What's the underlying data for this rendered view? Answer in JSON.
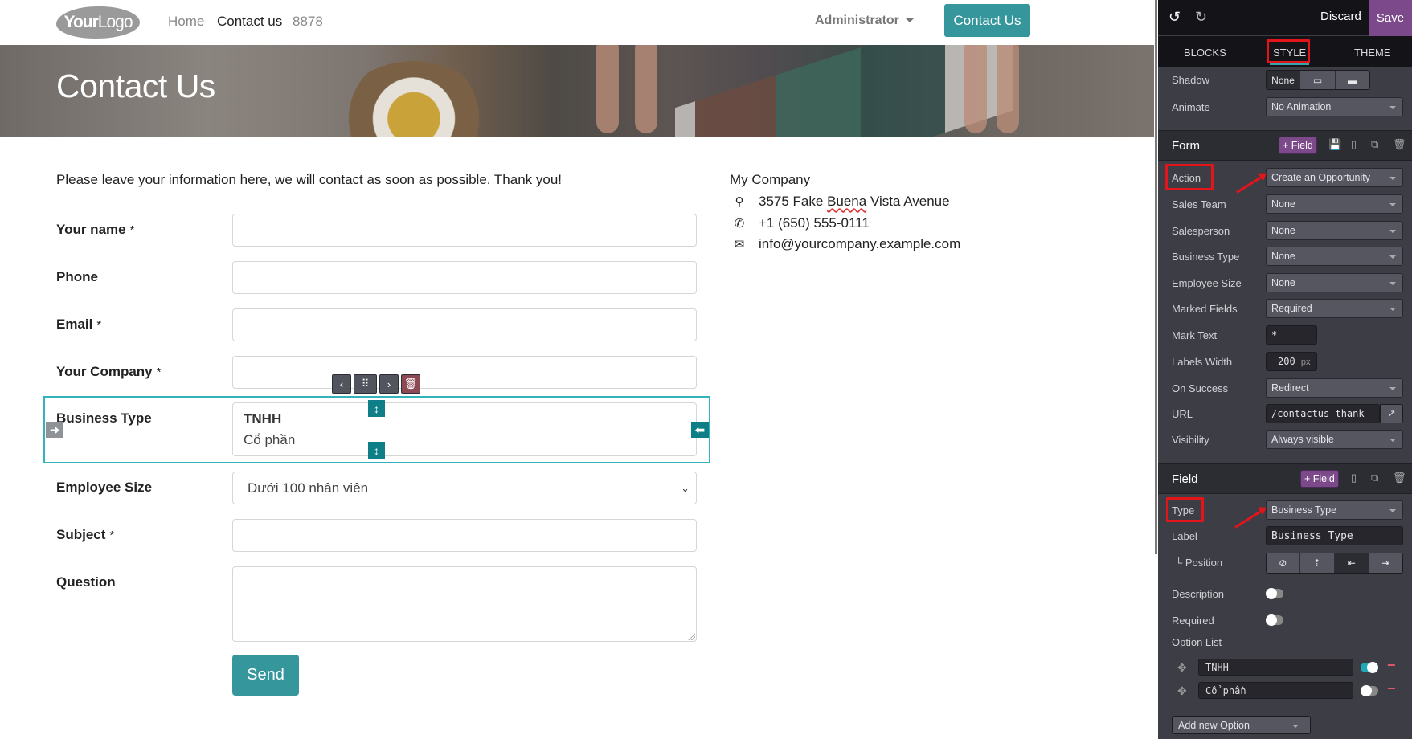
{
  "navbar": {
    "logo": {
      "bold": "Your",
      "light": "Logo"
    },
    "links": [
      {
        "label": "Home",
        "active": false
      },
      {
        "label": "Contact us",
        "active": true
      },
      {
        "label": "8878",
        "active": false
      }
    ],
    "user_menu": "Administrator",
    "cta_label": "Contact Us"
  },
  "hero": {
    "title": "Contact Us"
  },
  "intro": "Please leave your information here, we will contact as soon as possible. Thank you!",
  "form": {
    "required_mark": "*",
    "fields": [
      {
        "label": "Your name",
        "required": true,
        "type": "text",
        "value": ""
      },
      {
        "label": "Phone",
        "required": false,
        "type": "text",
        "value": ""
      },
      {
        "label": "Email",
        "required": true,
        "type": "text",
        "value": ""
      },
      {
        "label": "Your Company",
        "required": true,
        "type": "text",
        "value": ""
      },
      {
        "label": "Business Type",
        "required": false,
        "type": "radio",
        "options": [
          "TNHH",
          "Cổ phần"
        ]
      },
      {
        "label": "Employee Size",
        "required": false,
        "type": "select",
        "value": "Dưới 100 nhân viên"
      },
      {
        "label": "Subject",
        "required": true,
        "type": "text",
        "value": ""
      },
      {
        "label": "Question",
        "required": false,
        "type": "textarea",
        "value": ""
      }
    ],
    "send_label": "Send"
  },
  "company": {
    "name": "My Company",
    "address": {
      "pre": "3575 Fake ",
      "misspelled": "Buena",
      "post": " Vista Avenue"
    },
    "phone": "+1 (650) 555-0111",
    "email": "info@yourcompany.example.com"
  },
  "editor": {
    "discard_label": "Discard",
    "save_label": "Save",
    "tabs": [
      {
        "label": "BLOCKS",
        "active": false
      },
      {
        "label": "STYLE",
        "active": true
      },
      {
        "label": "THEME",
        "active": false
      }
    ],
    "shadow": {
      "label": "Shadow",
      "value": "None"
    },
    "animate": {
      "label": "Animate",
      "value": "No Animation"
    },
    "form_section": {
      "title": "Form",
      "add_field_label": "+ Field",
      "rows": [
        {
          "label": "Action",
          "value": "Create an Opportunity",
          "kind": "select"
        },
        {
          "label": "Sales Team",
          "value": "None",
          "kind": "select"
        },
        {
          "label": "Salesperson",
          "value": "None",
          "kind": "select"
        },
        {
          "label": "Business Type",
          "value": "None",
          "kind": "select"
        },
        {
          "label": "Employee Size",
          "value": "None",
          "kind": "select"
        },
        {
          "label": "Marked Fields",
          "value": "Required",
          "kind": "select"
        },
        {
          "label": "Mark Text",
          "value": "*",
          "kind": "input"
        },
        {
          "label": "Labels Width",
          "value": "200",
          "unit": "px",
          "kind": "input"
        },
        {
          "label": "On Success",
          "value": "Redirect",
          "kind": "select"
        },
        {
          "label": "URL",
          "value": "/contactus-thank",
          "kind": "url"
        },
        {
          "label": "Visibility",
          "value": "Always visible",
          "kind": "select"
        }
      ]
    },
    "field_section": {
      "title": "Field",
      "add_field_label": "+ Field",
      "type": {
        "label": "Type",
        "value": "Business Type"
      },
      "field_label": {
        "label": "Label",
        "value": "Business Type"
      },
      "position": {
        "label": "└ Position",
        "active_index": 2
      },
      "description": {
        "label": "Description",
        "on": false
      },
      "required": {
        "label": "Required",
        "on": false
      },
      "option_list_label": "Option List",
      "options": [
        {
          "value": "TNHH",
          "default": true
        },
        {
          "value": "Cổ  phần",
          "default": false
        }
      ],
      "add_option_label": "Add new Option"
    }
  }
}
